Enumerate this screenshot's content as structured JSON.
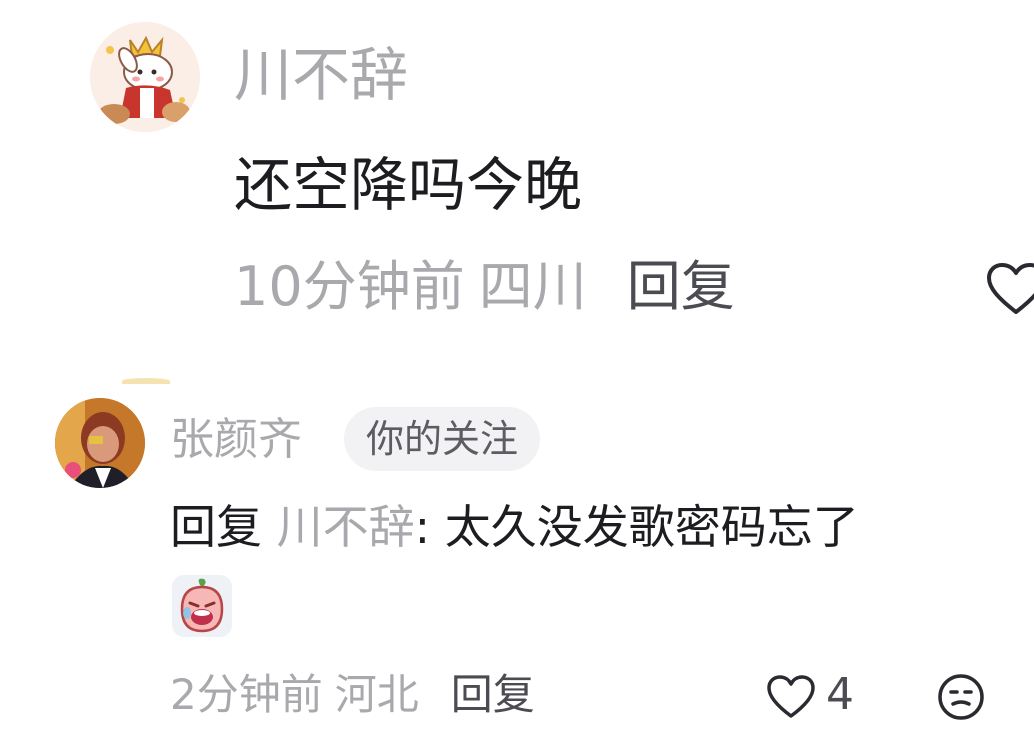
{
  "comments": [
    {
      "username": "川不辞",
      "avatar_icon": "bunny-character-avatar",
      "text": "还空降吗今晚",
      "time": "10分钟前",
      "location": "四川",
      "reply_label": "回复",
      "like_icon": "heart-outline-icon"
    },
    {
      "username": "张颜齐",
      "avatar_icon": "user-photo-avatar",
      "badge": "你的关注",
      "reply_prefix": "回复",
      "reply_to": "川不辞",
      "text": ": 太久没发歌密码忘了",
      "sticker_icon": "crying-peach-sticker",
      "time": "2分钟前",
      "location": "河北",
      "reply_label": "回复",
      "like_icon": "heart-outline-icon",
      "like_count": "4",
      "react_icon": "emoji-reaction-icon"
    }
  ],
  "colors": {
    "primary_text": "#1d1d21",
    "secondary_text": "#a9a9ad",
    "action_text": "#4b4b52",
    "badge_bg": "#f2f2f4"
  }
}
